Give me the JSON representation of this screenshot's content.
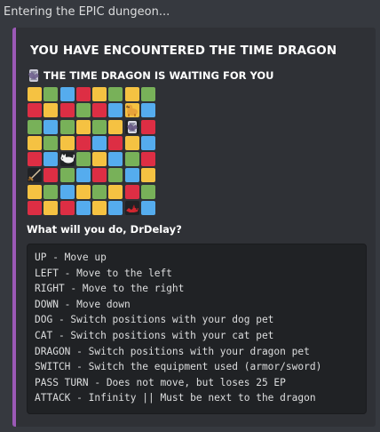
{
  "message": {
    "text": "Entering the EPIC dungeon..."
  },
  "embed": {
    "accent_color": "#9b59b6",
    "title": "YOU HAVE ENCOUNTERED THE TIME DRAGON",
    "subtitle": "THE TIME DRAGON IS WAITING FOR YOU",
    "subtitle_icon": "time-dragon-icon",
    "board": {
      "colors": {
        "Y": "#f5c242",
        "G": "#78b159",
        "R": "#dd2e44",
        "B": "#55acee",
        "K": "#202225"
      },
      "rows": [
        [
          "Y",
          "G",
          "B",
          "R",
          "Y",
          "G",
          "Y",
          "G"
        ],
        [
          "R",
          "Y",
          "R",
          "G",
          "R",
          "B",
          "Y",
          "B"
        ],
        [
          "G",
          "B",
          "G",
          "Y",
          "G",
          "Y",
          "K",
          "R"
        ],
        [
          "Y",
          "G",
          "Y",
          "R",
          "B",
          "R",
          "Y",
          "B"
        ],
        [
          "R",
          "B",
          "K",
          "G",
          "Y",
          "B",
          "G",
          "R"
        ],
        [
          "K",
          "R",
          "G",
          "B",
          "R",
          "G",
          "B",
          "Y"
        ],
        [
          "Y",
          "G",
          "B",
          "Y",
          "G",
          "Y",
          "R",
          "G"
        ],
        [
          "R",
          "Y",
          "R",
          "B",
          "Y",
          "B",
          "K",
          "B"
        ]
      ],
      "pieces": [
        {
          "row": 1,
          "col": 6,
          "icon": "dog-icon"
        },
        {
          "row": 2,
          "col": 6,
          "icon": "time-dragon-icon"
        },
        {
          "row": 4,
          "col": 2,
          "icon": "cat-icon"
        },
        {
          "row": 5,
          "col": 0,
          "icon": "sword-icon"
        },
        {
          "row": 7,
          "col": 6,
          "icon": "red-dragon-icon"
        }
      ]
    },
    "prompt": "What will you do, DrDelay?",
    "commands": [
      "UP - Move up",
      "LEFT - Move to the left",
      "RIGHT - Move to the right",
      "DOWN - Move down",
      "DOG - Switch positions with your dog pet",
      "CAT - Switch positions with your cat pet",
      "DRAGON - Switch positions with your dragon pet",
      "SWITCH - Switch the equipment used (armor/sword)",
      "PASS TURN - Does not move, but loses 25 EP",
      "ATTACK - Infinity || Must be next to the dragon"
    ]
  }
}
